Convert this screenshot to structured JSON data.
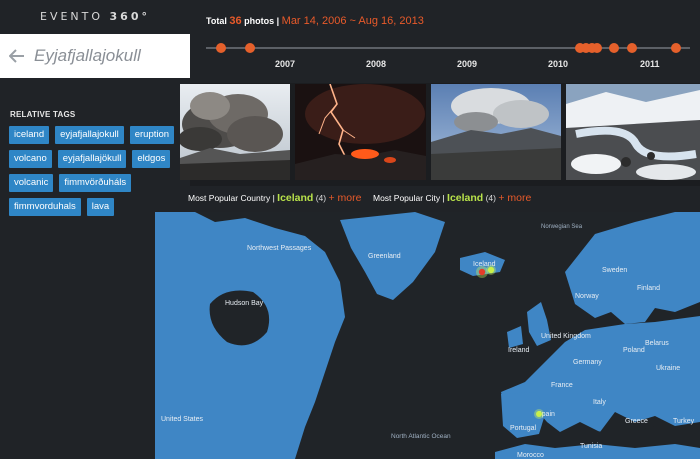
{
  "brand": {
    "name": "EVENTO",
    "num": "360°"
  },
  "search": {
    "query": "Eyjafjallajokull"
  },
  "sidebar": {
    "tags_title": "RELATIVE TAGS",
    "tags": [
      "iceland",
      "eyjafjallajokull",
      "eruption",
      "volcano",
      "eyjafjallajökull",
      "eldgos",
      "volcanic",
      "fimmvörðuháls",
      "fimmvorduhals",
      "lava"
    ]
  },
  "header": {
    "total_label": "Total",
    "total_count": "36",
    "photos_label": "photos |",
    "date_range": "Mar 14, 2006 ~ Aug 16, 2013"
  },
  "timeline": {
    "years": [
      "2007",
      "2008",
      "2009",
      "2010",
      "2011"
    ],
    "dot_color": "#e5602b"
  },
  "photos": [
    {
      "name": "ash-plume-photo"
    },
    {
      "name": "lightning-eruption-photo"
    },
    {
      "name": "volcano-plume-landscape-photo"
    },
    {
      "name": "snowy-river-photo"
    }
  ],
  "popular": {
    "country_label": "Most Popular Country |",
    "country": "Iceland",
    "country_count": "(4)",
    "city_label": "Most Popular City |",
    "city": "Iceland",
    "city_count": "(4)",
    "more": "+ more"
  },
  "map": {
    "labels": {
      "greenland": "Greenland",
      "iceland": "Iceland",
      "norwegian_sea": "Norwegian Sea",
      "sweden": "Sweden",
      "norway": "Norway",
      "finland": "Finland",
      "united_kingdom": "United Kingdom",
      "ireland": "Ireland",
      "germany": "Germany",
      "poland": "Poland",
      "belarus": "Belarus",
      "ukraine": "Ukraine",
      "france": "France",
      "italy": "Italy",
      "greece": "Greece",
      "turkey": "Turkey",
      "spain": "Spain",
      "portugal": "Portugal",
      "morocco": "Morocco",
      "tunisia": "Tunisia",
      "hudson_bay": "Hudson Bay",
      "united_states": "United States",
      "north_atlantic_ocean": "North Atlantic Ocean",
      "nw_passages": "Northwest Passages"
    }
  }
}
